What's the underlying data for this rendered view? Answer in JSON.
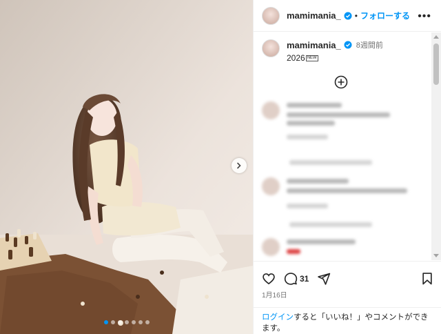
{
  "post": {
    "username": "mamimania_",
    "follow_label": "フォローする",
    "separator": "•",
    "more_label": "•••"
  },
  "caption": {
    "username": "mamimania_",
    "time_ago": "8週間前",
    "text": "2026",
    "badge": "NEW"
  },
  "icons": {
    "verified": "verified-badge-icon",
    "more": "more-options-icon",
    "plus": "add-circle-icon",
    "like": "heart-icon",
    "comment": "comment-bubble-icon",
    "share": "paper-plane-icon",
    "save": "bookmark-icon",
    "next": "chevron-right-icon"
  },
  "actions": {
    "comment_count": "31",
    "date": "1月16日"
  },
  "login_prompt": {
    "link": "ログイン",
    "text": "すると「いいね！」やコメントができます。"
  },
  "carousel": {
    "slide_count": 7,
    "active_index": 0
  },
  "colors": {
    "accent": "#0095f6",
    "text": "#262626",
    "muted": "#737373"
  }
}
